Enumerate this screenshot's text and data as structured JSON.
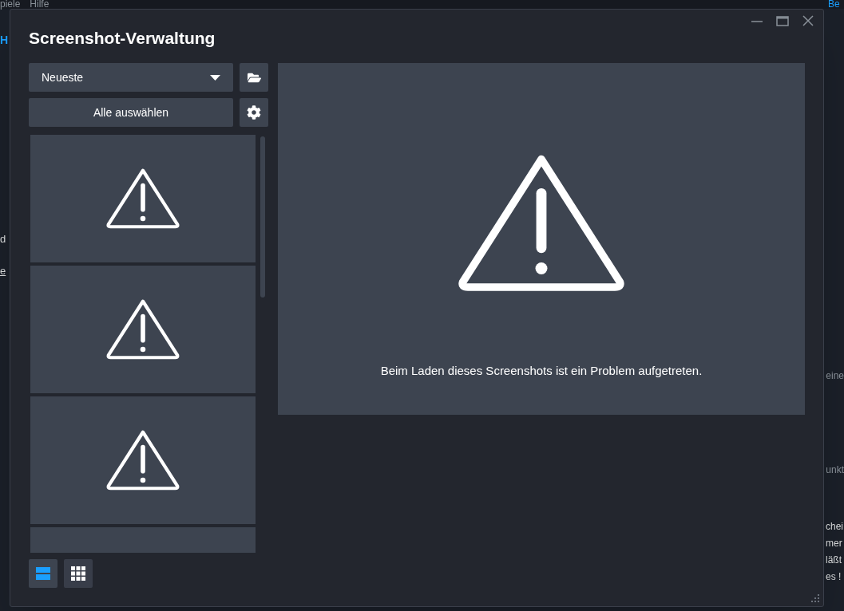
{
  "background": {
    "menu": [
      "piele",
      "Hilfe"
    ],
    "tab": "H",
    "right_tab": "Be",
    "left_fragments": [
      "d",
      "e"
    ],
    "right_fragments": [
      "eine",
      "unkt",
      "chei",
      "mer",
      "läßt",
      "es !"
    ]
  },
  "dialog": {
    "title": "Screenshot-Verwaltung",
    "sort": {
      "value": "Neueste"
    },
    "select_all": "Alle auswählen",
    "thumbnails": [
      {
        "kind": "error"
      },
      {
        "kind": "error"
      },
      {
        "kind": "error"
      },
      {
        "kind": "blank"
      }
    ],
    "preview": {
      "kind": "error",
      "message": "Beim Laden dieses Screenshots ist ein Problem aufgetreten."
    },
    "views": [
      {
        "kind": "list",
        "selected": true
      },
      {
        "kind": "grid",
        "selected": false
      }
    ]
  }
}
